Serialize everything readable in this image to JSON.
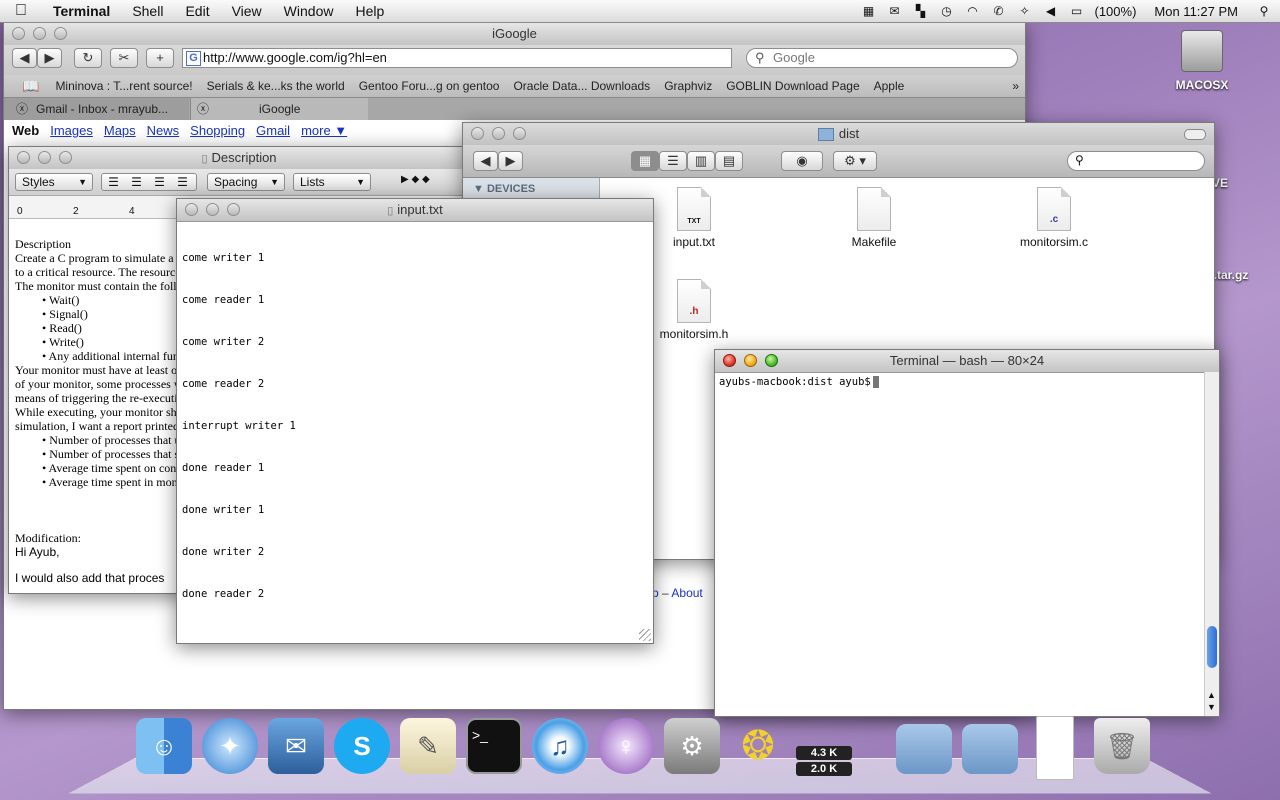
{
  "menubar": {
    "app": "Terminal",
    "items": [
      "Shell",
      "Edit",
      "View",
      "Window",
      "Help"
    ],
    "battery": "(100%)",
    "clock": "Mon 11:27 PM"
  },
  "desktop": {
    "disk_label": "MACOSX",
    "partial_labels": [
      "VE",
      "2.tar.gz"
    ]
  },
  "safari": {
    "title": "iGoogle",
    "url": "http://www.google.com/ig?hl=en",
    "search_placeholder": "Google",
    "bookmarks": [
      "Mininova : T...rent source!",
      "Serials & ke...ks the world",
      "Gentoo Foru...g on gentoo",
      "Oracle Data... Downloads",
      "Graphviz",
      "GOBLIN Download Page",
      "Apple"
    ],
    "tabs": [
      "Gmail - Inbox - mrayub...",
      "iGoogle"
    ],
    "google_nav": [
      "Web",
      "Images",
      "Maps",
      "News",
      "Shopping",
      "Gmail",
      "more ▼"
    ],
    "footer_partial": "p",
    "footer_about": "About"
  },
  "textedit": {
    "title": "Description",
    "styles": "Styles",
    "spacing": "Spacing",
    "lists": "Lists",
    "ruler": [
      "0",
      "2",
      "4"
    ],
    "lines": [
      "Description",
      "Create a C program to simulate a m",
      "to a critical resource. The resource",
      "The monitor must contain the follo"
    ],
    "bullets1": [
      "• Wait()",
      "• Signal()",
      "• Read()",
      "• Write()",
      "• Any additional internal func"
    ],
    "lines2": [
      "Your monitor must have at least on",
      "of your monitor, some processes w",
      "means of triggering the re-executio",
      "While executing, your monitor sho",
      "simulation, I want a report printed"
    ],
    "bullets2": [
      "• Number of processes that u",
      "• Number of processes that s",
      "• Average time spent on cond",
      "• Average time spent in moni"
    ],
    "modification": "Modification:",
    "greeting": "Hi Ayub,",
    "last": "I would also add that proces"
  },
  "inputtxt": {
    "title": "input.txt",
    "lines": [
      "come writer 1",
      "come reader 1",
      "come writer 2",
      "come reader 2",
      "interrupt writer 1",
      "done reader 1",
      "done writer 1",
      "done writer 2",
      "done reader 2"
    ]
  },
  "finder": {
    "title": "dist",
    "section": "DEVICES",
    "files": [
      {
        "name": "input.txt",
        "tag": "TXT"
      },
      {
        "name": "Makefile",
        "tag": ""
      },
      {
        "name": "monitorsim.c",
        "tag": ".c"
      },
      {
        "name": "monitorsim.h",
        "tag": ".h"
      }
    ]
  },
  "terminal": {
    "title": "Terminal — bash — 80×24",
    "prompt": "ayubs-macbook:dist ayub$"
  },
  "dock": {
    "apps": [
      "finder-icon",
      "safari-icon",
      "mail-icon",
      "skype-icon",
      "textedit-icon",
      "terminal-icon",
      "itunes-icon",
      "adium-icon",
      "system-preferences-icon",
      "cyberduck-icon",
      "network-monitor-icon",
      "applications-folder-icon",
      "documents-folder-icon",
      "document-stack-icon",
      "trash-icon"
    ],
    "net_up": "4.3 K",
    "net_down": "2.0 K"
  }
}
